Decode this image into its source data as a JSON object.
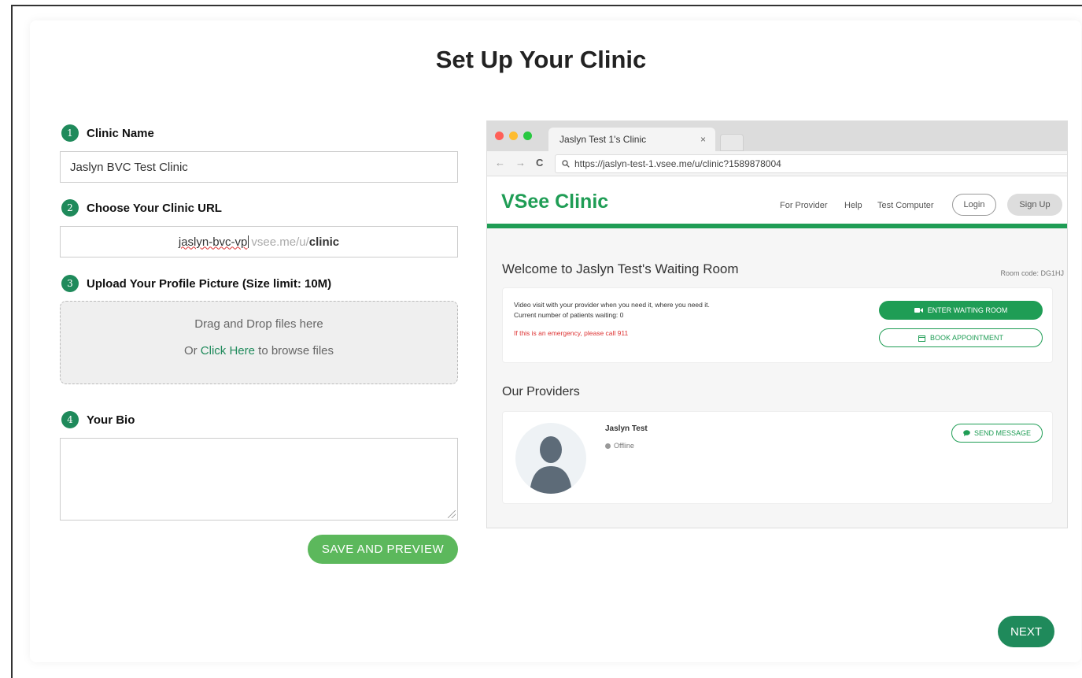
{
  "page": {
    "title": "Set Up Your Clinic"
  },
  "steps": [
    {
      "num": "1",
      "label": "Clinic Name"
    },
    {
      "num": "2",
      "label": "Choose Your Clinic URL"
    },
    {
      "num": "3",
      "label": "Upload Your Profile Picture (Size limit: 10M)"
    },
    {
      "num": "4",
      "label": "Your Bio"
    }
  ],
  "clinic_name": {
    "value": "Jaslyn BVC Test Clinic"
  },
  "clinic_url": {
    "value": "jaslyn-bvc-vp",
    "domain": "vsee.me/u/",
    "path": "clinic"
  },
  "upload": {
    "line1": "Drag and Drop files here",
    "prefix": "Or ",
    "link": "Click Here",
    "suffix": " to browse files"
  },
  "bio": {
    "value": ""
  },
  "buttons": {
    "save": "SAVE AND PREVIEW",
    "next": "NEXT"
  },
  "colors": {
    "primary": "#1f8a5b",
    "save_button": "#5cb85c",
    "site_accent": "#1f9d55",
    "emergency": "#dd3333"
  },
  "preview": {
    "tab_title": "Jaslyn Test 1's Clinic",
    "tab_close": "×",
    "url": "https://jaslyn-test-1.vsee.me/u/clinic?1589878004",
    "logo": "VSee Clinic",
    "nav": [
      "For Provider",
      "Help",
      "Test Computer"
    ],
    "login": "Login",
    "signup": "Sign Up",
    "welcome": "Welcome to Jaslyn Test's Waiting Room",
    "room_code": "Room code: DG1HJ",
    "visit_text": "Video visit with your provider when you need it, where you need it.",
    "patients_waiting": "Current number of patients waiting: 0",
    "emergency": "If this is an emergency, please call 911",
    "enter_button": "ENTER WAITING ROOM",
    "book_button": "BOOK APPOINTMENT",
    "providers_title": "Our Providers",
    "provider_name": "Jaslyn Test",
    "provider_status": "Offline",
    "message_button": "SEND MESSAGE"
  }
}
